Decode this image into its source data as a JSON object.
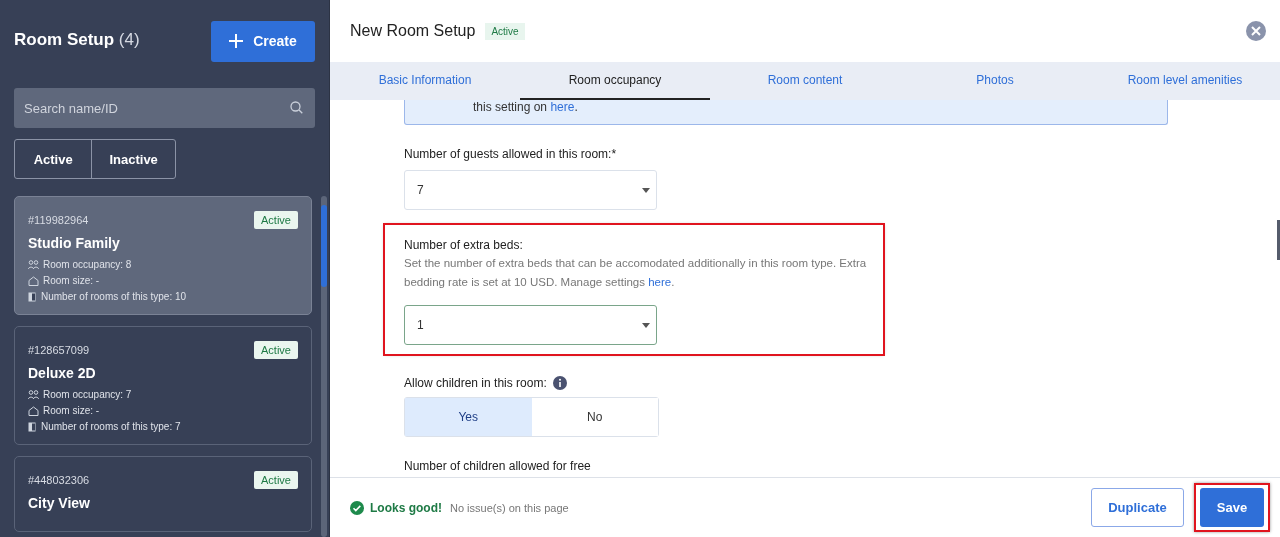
{
  "sidebar": {
    "title": "Room Setup",
    "count": "(4)",
    "create_button": "Create",
    "search": {
      "placeholder": "Search name/ID"
    },
    "filters": [
      {
        "label": "Active"
      },
      {
        "label": "Inactive"
      }
    ],
    "rooms": [
      {
        "id": "#119982964",
        "status": "Active",
        "name": "Studio Family",
        "selected": true,
        "occupancy": "Room occupancy: 8",
        "size": "Room size: -",
        "count": "Number of rooms of this type: 10"
      },
      {
        "id": "#128657099",
        "status": "Active",
        "name": "Deluxe 2D",
        "selected": false,
        "occupancy": "Room occupancy: 7",
        "size": "Room size: -",
        "count": "Number of rooms of this type: 7"
      },
      {
        "id": "#448032306",
        "status": "Active",
        "name": "City View",
        "selected": false
      }
    ]
  },
  "panel": {
    "title": "New Room Setup",
    "status": "Active",
    "tabs": [
      {
        "label": "Basic Information",
        "selected": false
      },
      {
        "label": "Room occupancy",
        "selected": true
      },
      {
        "label": "Room content",
        "selected": false
      },
      {
        "label": "Photos",
        "selected": false
      },
      {
        "label": "Room level amenities",
        "selected": false
      }
    ],
    "info_box": {
      "text": "this setting on",
      "link": "here",
      "end": "."
    },
    "fields": [
      {
        "kind": "select",
        "label": "Number of guests allowed in this room:*",
        "value": "7",
        "highlighted": false
      },
      {
        "kind": "select",
        "label": "Number of extra beds:",
        "description": "Set the number of extra beds that can be accomodated additionally in this room type. Extra bedding rate is set at 10 USD. Manage settings",
        "link": "here",
        "end": ".",
        "value": "1",
        "highlighted": true
      },
      {
        "kind": "toggle",
        "label": "Allow children in this room:",
        "options": [
          {
            "label": "Yes",
            "selected": true
          },
          {
            "label": "No",
            "selected": false
          }
        ]
      },
      {
        "kind": "label",
        "label": "Number of children allowed for free"
      }
    ]
  },
  "footer": {
    "status": "Looks good!",
    "message": "No issue(s) on this page",
    "buttons": [
      {
        "label": "Duplicate",
        "kind": "secondary",
        "highlighted": false
      },
      {
        "label": "Save",
        "kind": "primary",
        "highlighted": true
      }
    ]
  }
}
